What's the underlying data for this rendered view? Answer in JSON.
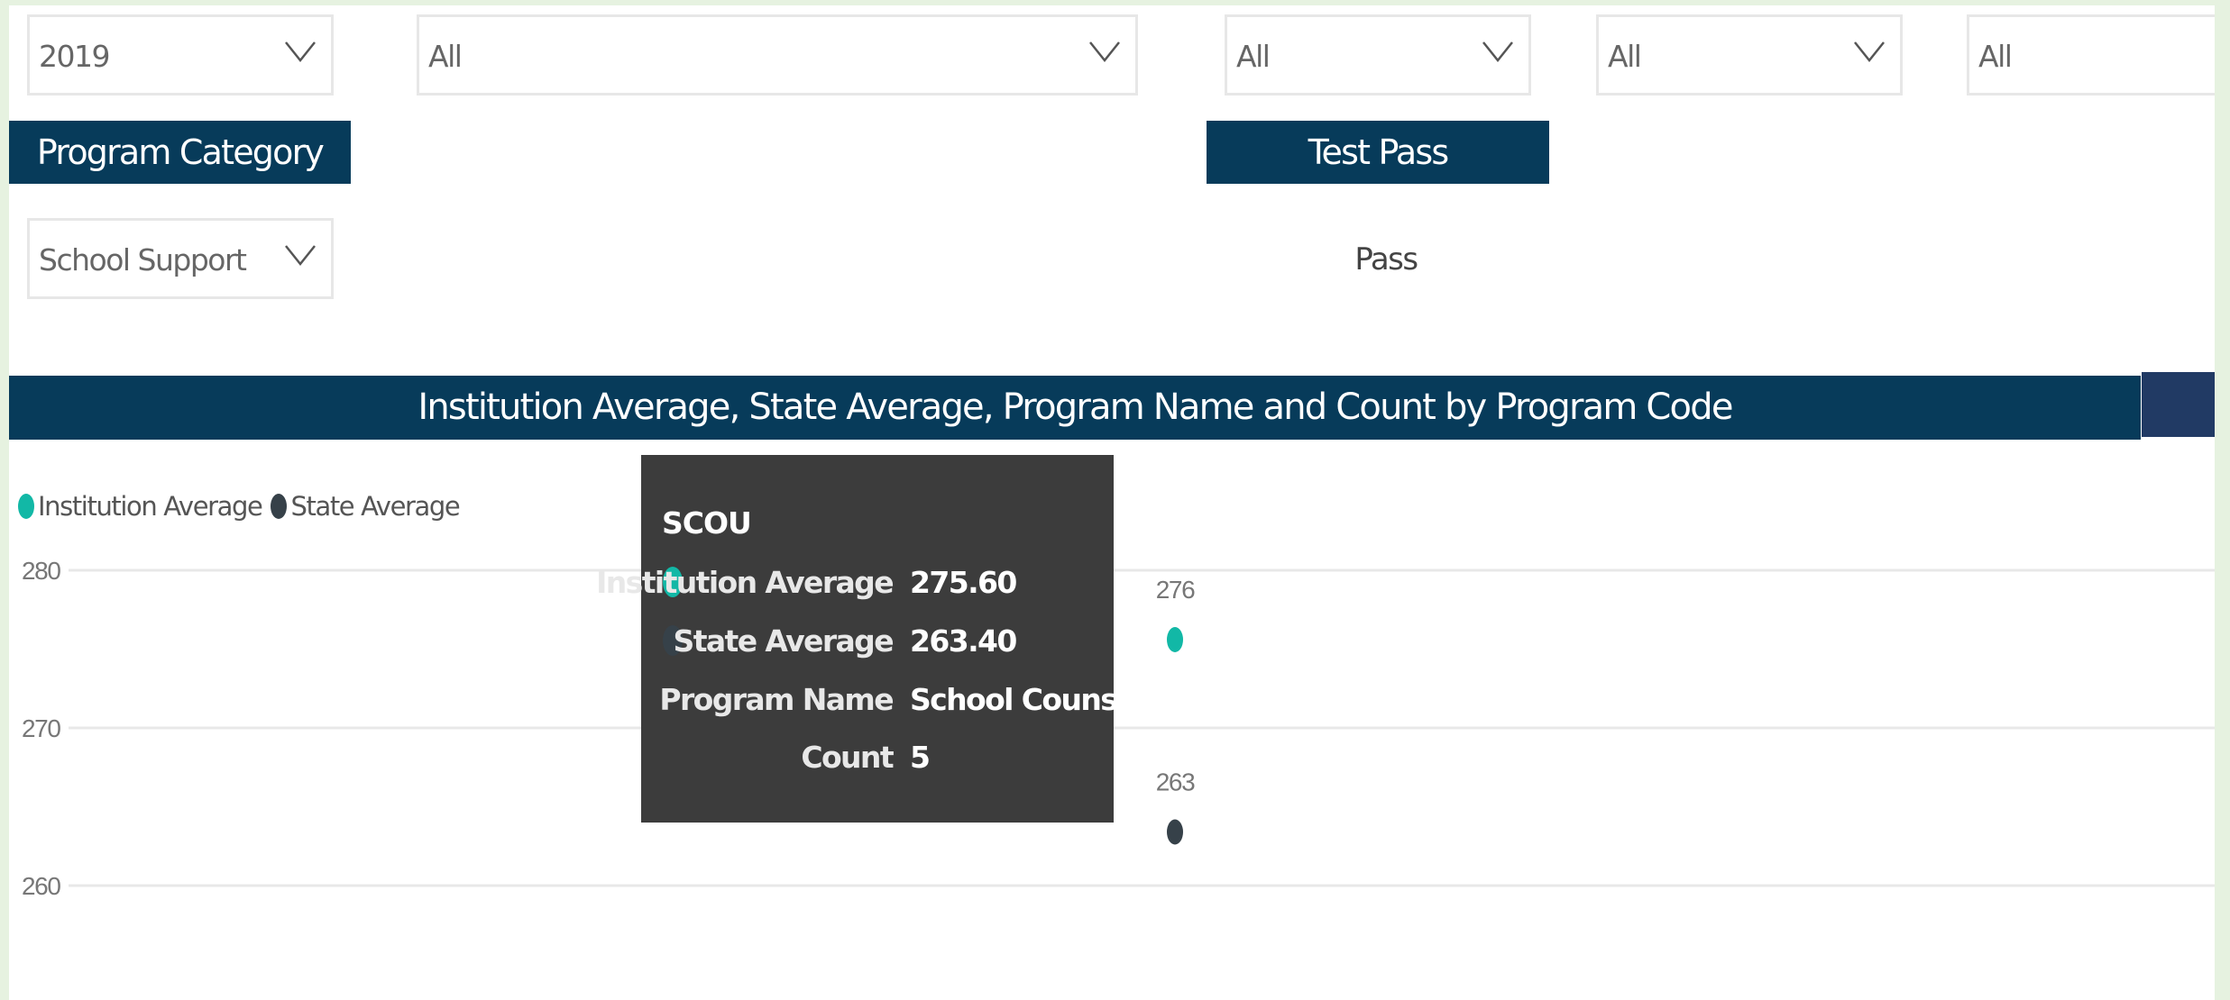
{
  "colors": {
    "accent_header": "#073b5a",
    "institution_series": "#12b8a6",
    "state_series": "#364149",
    "tooltip_bg": "#3c3c3c"
  },
  "filters": {
    "year": {
      "value": "2019",
      "icon": "chevron-down-icon"
    },
    "filter2": {
      "value": "All",
      "icon": "chevron-down-icon"
    },
    "filter3": {
      "value": "All",
      "icon": "chevron-down-icon"
    },
    "filter4": {
      "value": "All",
      "icon": "chevron-down-icon"
    },
    "filter5": {
      "value": "All",
      "icon": "chevron-down-icon"
    }
  },
  "program_category": {
    "header": "Program Category",
    "value": "School Support"
  },
  "test_pass": {
    "header": "Test Pass",
    "value": "Pass"
  },
  "chart_data": {
    "type": "scatter",
    "title": "Institution Average, State Average, Program Name and Count by Program Code",
    "legend": [
      {
        "name": "Institution Average",
        "color": "#12b8a6"
      },
      {
        "name": "State Average",
        "color": "#364149"
      }
    ],
    "legend_position": "top-left",
    "y_ticks": [
      280,
      270,
      260
    ],
    "ylim": [
      254,
      281
    ],
    "grid": true,
    "categories": [
      "SCOU"
    ],
    "series": [
      {
        "name": "Institution Average",
        "values": [
          275.6
        ],
        "labels": [
          "276"
        ]
      },
      {
        "name": "State Average",
        "values": [
          263.4
        ],
        "labels": [
          "263"
        ]
      }
    ]
  },
  "tooltip": {
    "code": "SCOU",
    "rows": [
      {
        "label": "Institution Average",
        "value": "275.60"
      },
      {
        "label": "State Average",
        "value": "263.40"
      },
      {
        "label": "Program Name",
        "value": "School Counselor"
      },
      {
        "label": "Count",
        "value": "5"
      }
    ]
  }
}
